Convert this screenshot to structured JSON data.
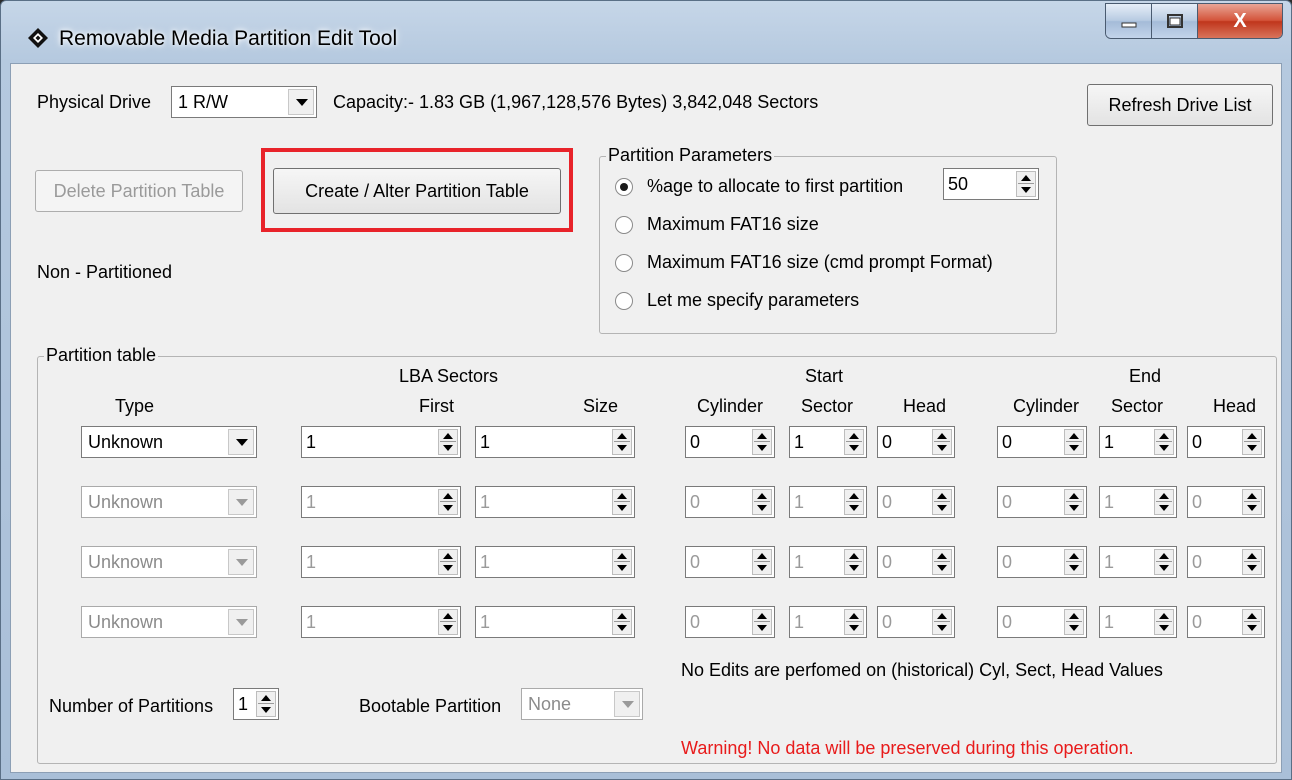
{
  "window": {
    "title": "Removable Media Partition Edit Tool",
    "close_label": "X"
  },
  "drive": {
    "label": "Physical Drive",
    "selected": "1 R/W",
    "capacity": "Capacity:- 1.83 GB (1,967,128,576 Bytes) 3,842,048 Sectors",
    "refresh_label": "Refresh Drive List"
  },
  "actions": {
    "delete_label": "Delete Partition Table",
    "create_label": "Create / Alter Partition Table",
    "status": "Non - Partitioned"
  },
  "params": {
    "legend": "Partition Parameters",
    "options": [
      "%age to allocate to first partition",
      "Maximum FAT16 size",
      "Maximum FAT16 size (cmd prompt Format)",
      "Let me specify parameters"
    ],
    "selected_index": 0,
    "percent": "50"
  },
  "table": {
    "legend": "Partition table",
    "headers": {
      "lba": "LBA Sectors",
      "start": "Start",
      "end": "End",
      "type": "Type",
      "first": "First",
      "size": "Size",
      "cylinder": "Cylinder",
      "sector": "Sector",
      "head": "Head"
    },
    "rows": [
      {
        "type": "Unknown",
        "first": "1",
        "size": "1",
        "s_cyl": "0",
        "s_sec": "1",
        "s_head": "0",
        "e_cyl": "0",
        "e_sec": "1",
        "e_head": "0",
        "enabled": true
      },
      {
        "type": "Unknown",
        "first": "1",
        "size": "1",
        "s_cyl": "0",
        "s_sec": "1",
        "s_head": "0",
        "e_cyl": "0",
        "e_sec": "1",
        "e_head": "0",
        "enabled": false
      },
      {
        "type": "Unknown",
        "first": "1",
        "size": "1",
        "s_cyl": "0",
        "s_sec": "1",
        "s_head": "0",
        "e_cyl": "0",
        "e_sec": "1",
        "e_head": "0",
        "enabled": false
      },
      {
        "type": "Unknown",
        "first": "1",
        "size": "1",
        "s_cyl": "0",
        "s_sec": "1",
        "s_head": "0",
        "e_cyl": "0",
        "e_sec": "1",
        "e_head": "0",
        "enabled": false
      }
    ],
    "note": "No Edits are perfomed on (historical) Cyl, Sect, Head Values"
  },
  "footer": {
    "num_partitions_label": "Number of Partitions",
    "num_partitions": "1",
    "bootable_label": "Bootable Partition",
    "bootable": "None",
    "warning": "Warning! No data will be preserved during this operation."
  },
  "colors": {
    "warning": "#e81b1b",
    "highlight": "#e8232a"
  }
}
